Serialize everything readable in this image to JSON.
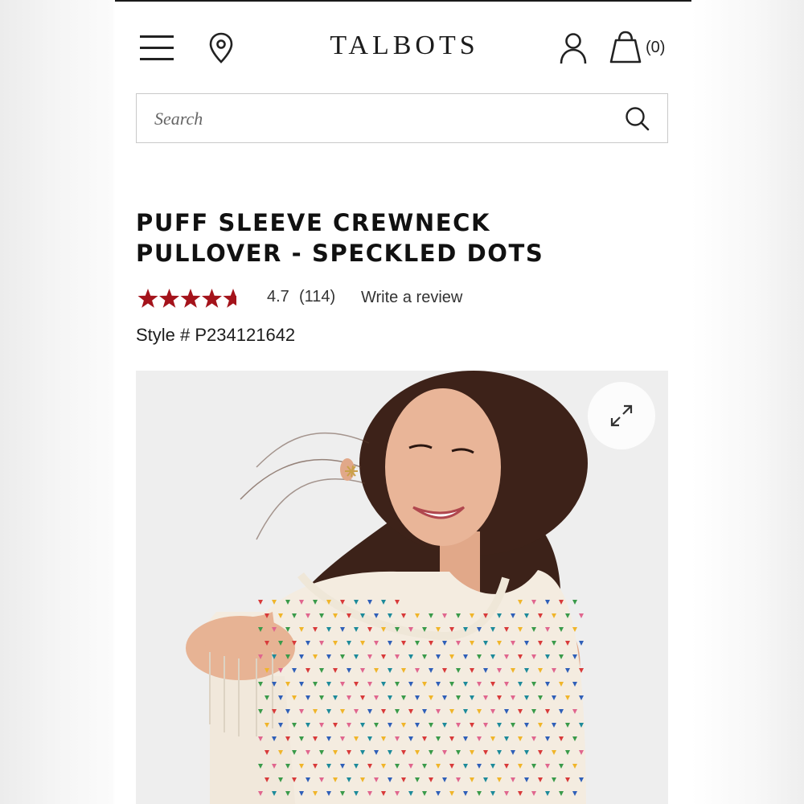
{
  "header": {
    "logo": "TALBOTS",
    "cart_count": "(0)",
    "icons": [
      "menu-icon",
      "location-pin-icon",
      "account-icon",
      "shopping-bag-icon"
    ]
  },
  "search": {
    "placeholder": "Search",
    "icon": "search-icon"
  },
  "product": {
    "title_line1": "PUFF SLEEVE CREWNECK",
    "title_line2": "PULLOVER - SPECKLED DOTS",
    "rating": "4.7",
    "review_count": "(114)",
    "write_review": "Write a review",
    "style_number": "Style # P234121642",
    "star_fraction": 0.94
  },
  "colors": {
    "star": "#a4131b",
    "text": "#111111",
    "border": "#c9c9c9"
  },
  "image": {
    "expand_icon": "expand-icon"
  }
}
